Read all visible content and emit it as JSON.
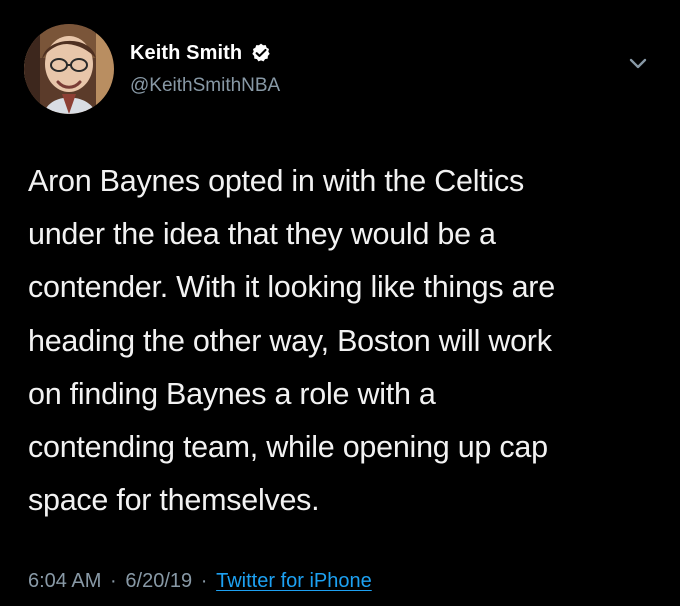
{
  "tweet": {
    "author": {
      "display_name": "Keith Smith",
      "handle": "@KeithSmithNBA",
      "verified_icon": "verified-badge-icon"
    },
    "text": "Aron Baynes opted in with the Celtics\nunder the idea that they would be a\ncontender. With it looking like things are\nheading the other way, Boston will work\non finding Baynes a role with a\ncontending team, while opening up cap\nspace for themselves.",
    "meta": {
      "time": "6:04 AM",
      "separator_1": "·",
      "date": "6/20/19",
      "separator_2": "·",
      "source": "Twitter for iPhone"
    },
    "menu_icon": "chevron-down-icon"
  },
  "colors": {
    "background": "#000000",
    "text": "#f2f2f2",
    "secondary": "#8899a6",
    "link": "#1da1f2",
    "verified": "#ffffff"
  }
}
